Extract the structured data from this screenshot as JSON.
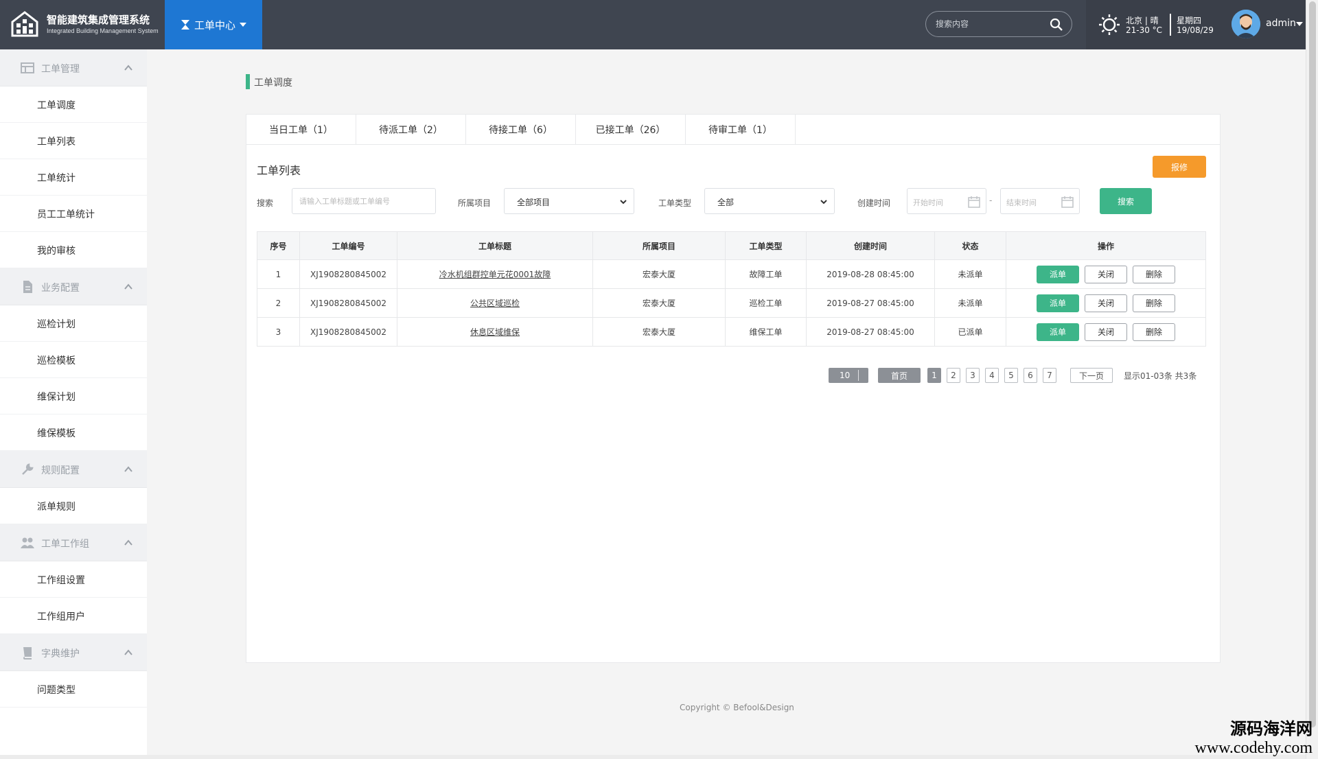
{
  "app": {
    "title": "智能建筑集成管理系统",
    "subtitle": "Integrated Building Management System",
    "module": "工单中心"
  },
  "header": {
    "search_placeholder": "搜索内容",
    "weather_city": "北京 | 晴",
    "weather_temp": "21-30 °C",
    "weekday": "星期四",
    "date": "19/08/29",
    "user": "admin"
  },
  "sidebar": {
    "groups": [
      {
        "label": "工单管理",
        "icon": "list-icon",
        "items": [
          "工单调度",
          "工单列表",
          "工单统计",
          "员工工单统计",
          "我的审核"
        ]
      },
      {
        "label": "业务配置",
        "icon": "document-icon",
        "items": [
          "巡检计划",
          "巡检模板",
          "维保计划",
          "维保模板"
        ]
      },
      {
        "label": "规则配置",
        "icon": "wrench-icon",
        "items": [
          "派单规则"
        ]
      },
      {
        "label": "工单工作组",
        "icon": "group-icon",
        "items": [
          "工作组设置",
          "工作组用户"
        ]
      },
      {
        "label": "字典维护",
        "icon": "book-icon",
        "items": [
          "问题类型"
        ]
      }
    ]
  },
  "breadcrumb": "工单调度",
  "tabs": [
    "当日工单（1）",
    "待派工单（2）",
    "待接工单（6）",
    "已接工单（26）",
    "待审工单（1）"
  ],
  "list": {
    "title": "工单列表",
    "report_button": "报修",
    "filters": {
      "search_label": "搜索",
      "search_placeholder": "请输入工单标题或工单编号",
      "project_label": "所属项目",
      "project_value": "全部项目",
      "type_label": "工单类型",
      "type_value": "全部",
      "time_label": "创建时间",
      "start_placeholder": "开始时间",
      "separator": "-",
      "end_placeholder": "结束时间",
      "search_button": "搜索"
    },
    "columns": [
      "序号",
      "工单编号",
      "工单标题",
      "所属项目",
      "工单类型",
      "创建时间",
      "状态",
      "操作"
    ],
    "rows": [
      {
        "no": "1",
        "code": "XJ1908280845002",
        "title": "冷水机组群控单元花0001故障",
        "project": "宏泰大厦",
        "type": "故障工单",
        "created": "2019-08-28 08:45:00",
        "status": "未派单",
        "status_color": "#444444"
      },
      {
        "no": "2",
        "code": "XJ1908280845002",
        "title": "公共区域巡检",
        "project": "宏泰大厦",
        "type": "巡检工单",
        "created": "2019-08-27 08:45:00",
        "status": "未派单",
        "status_color": "#444444"
      },
      {
        "no": "3",
        "code": "XJ1908280845002",
        "title": "休息区域维保",
        "project": "宏泰大厦",
        "type": "维保工单",
        "created": "2019-08-27 08:45:00",
        "status": "已派单",
        "status_color": "#f59a2b"
      }
    ],
    "actions": {
      "dispatch": "派单",
      "close": "关闭",
      "delete": "删除"
    }
  },
  "pagination": {
    "page_size": "10",
    "first": "首页",
    "pages": [
      "1",
      "2",
      "3",
      "4",
      "5",
      "6",
      "7"
    ],
    "active_page": "1",
    "next": "下一页",
    "info": "显示01-03条 共3条"
  },
  "footer": {
    "copyright": "Copyright © Befool&Design"
  },
  "watermark": {
    "line1": "源码海洋网",
    "line2": "www.codehy.com"
  },
  "colors": {
    "topbar": "#3f4550",
    "module_tab": "#1e77d3",
    "accent_green": "#3db589",
    "accent_orange": "#f59a2b"
  }
}
